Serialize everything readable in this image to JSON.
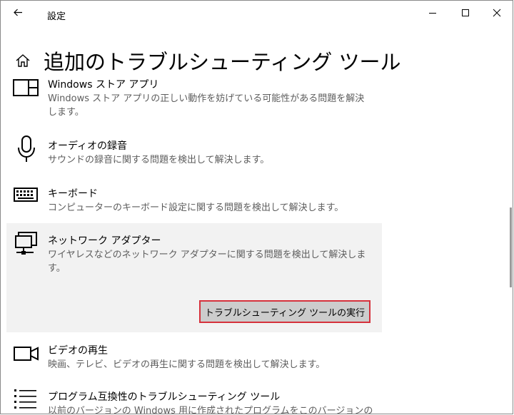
{
  "window": {
    "title": "設定"
  },
  "page": {
    "title": "追加のトラブルシューティング ツール"
  },
  "items": [
    {
      "name": "Windows ストア アプリ",
      "desc": "Windows ストア アプリの正しい動作を妨げている可能性がある問題を解決します。",
      "icon": "store-app-icon"
    },
    {
      "name": "オーディオの録音",
      "desc": "サウンドの録音に関する問題を検出して解決します。",
      "icon": "microphone-icon"
    },
    {
      "name": "キーボード",
      "desc": "コンピューターのキーボード設定に関する問題を検出して解決します。",
      "icon": "keyboard-icon"
    },
    {
      "name": "ネットワーク アダプター",
      "desc": "ワイヤレスなどのネットワーク アダプターに関する問題を検出して解決します。",
      "icon": "network-adapter-icon",
      "selected": true
    },
    {
      "name": "ビデオの再生",
      "desc": "映画、テレビ、ビデオの再生に関する問題を検出して解決します。",
      "icon": "video-camera-icon"
    },
    {
      "name": "プログラム互換性のトラブルシューティング ツール",
      "desc": "以前のバージョンの Windows 用に作成されたプログラムをこのバージョンの",
      "icon": "program-list-icon"
    }
  ],
  "run_button": {
    "label": "トラブルシューティング ツールの実行"
  },
  "colors": {
    "selected_bg": "#f2f2f2",
    "button_bg": "#cccccc",
    "focus_border": "#d6313c",
    "desc_text": "#5d5d5d"
  }
}
